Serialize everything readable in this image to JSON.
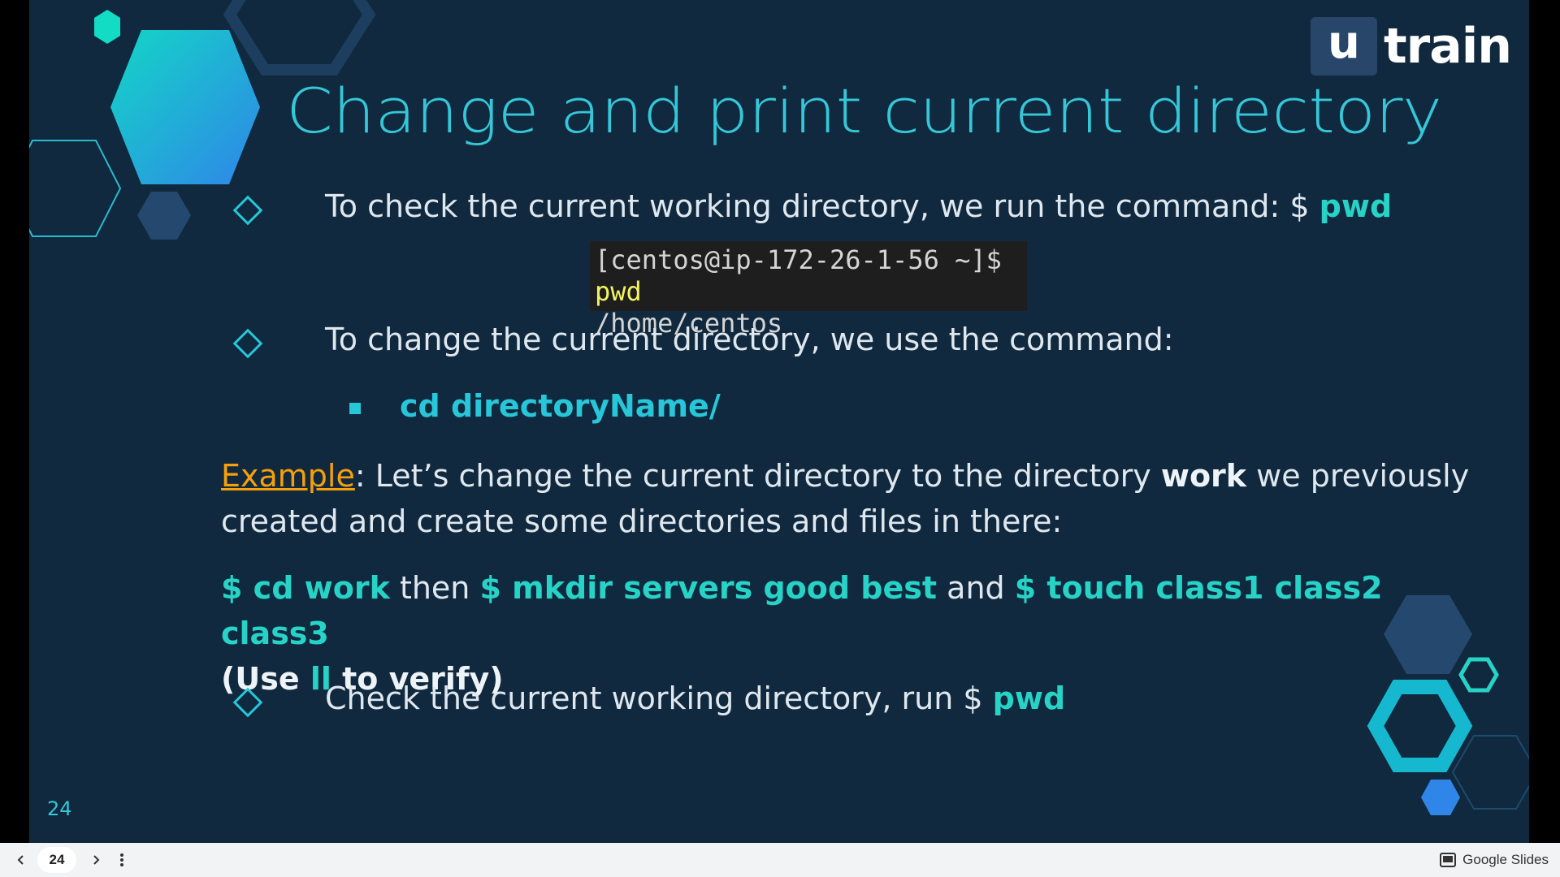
{
  "slide": {
    "logo": {
      "box": "u",
      "text": "train"
    },
    "title": "Change and print current directory",
    "bullet1": {
      "text": "To check the current working directory, we run the command: $ ",
      "cmd": "pwd"
    },
    "terminal": {
      "prompt": "[centos@ip-172-26-1-56 ~]$ ",
      "cmd": "pwd",
      "output": "/home/centos"
    },
    "bullet2": {
      "text": "To change the current directory, we use the command:"
    },
    "subbullet": "cd directoryName/",
    "example": {
      "label": "Example",
      "text_a": ": Let’s change the current directory to the directory ",
      "bold_word": "work",
      "text_b": " we previously created and create some directories and files in there:"
    },
    "commands": {
      "cmd1": "$ cd work",
      "then": " then ",
      "cmd2": "$ mkdir servers good best",
      "and": " and  ",
      "cmd3": "$ touch class1 class2 class3",
      "verify_a": "(Use ",
      "verify_ll": "ll",
      "verify_b": " to verify)"
    },
    "bullet3": {
      "text": "Check the current working directory, run $ ",
      "cmd": "pwd"
    },
    "page_number": "24"
  },
  "toolbar": {
    "prev_icon": "chevron-left-icon",
    "page": "24",
    "next_icon": "chevron-right-icon",
    "more_icon": "more-vert-icon",
    "app_label": "Google Slides"
  },
  "colors": {
    "background": "#10293e",
    "accent": "#27d3c7",
    "title": "#35c7d8",
    "example": "#f59f0b"
  }
}
